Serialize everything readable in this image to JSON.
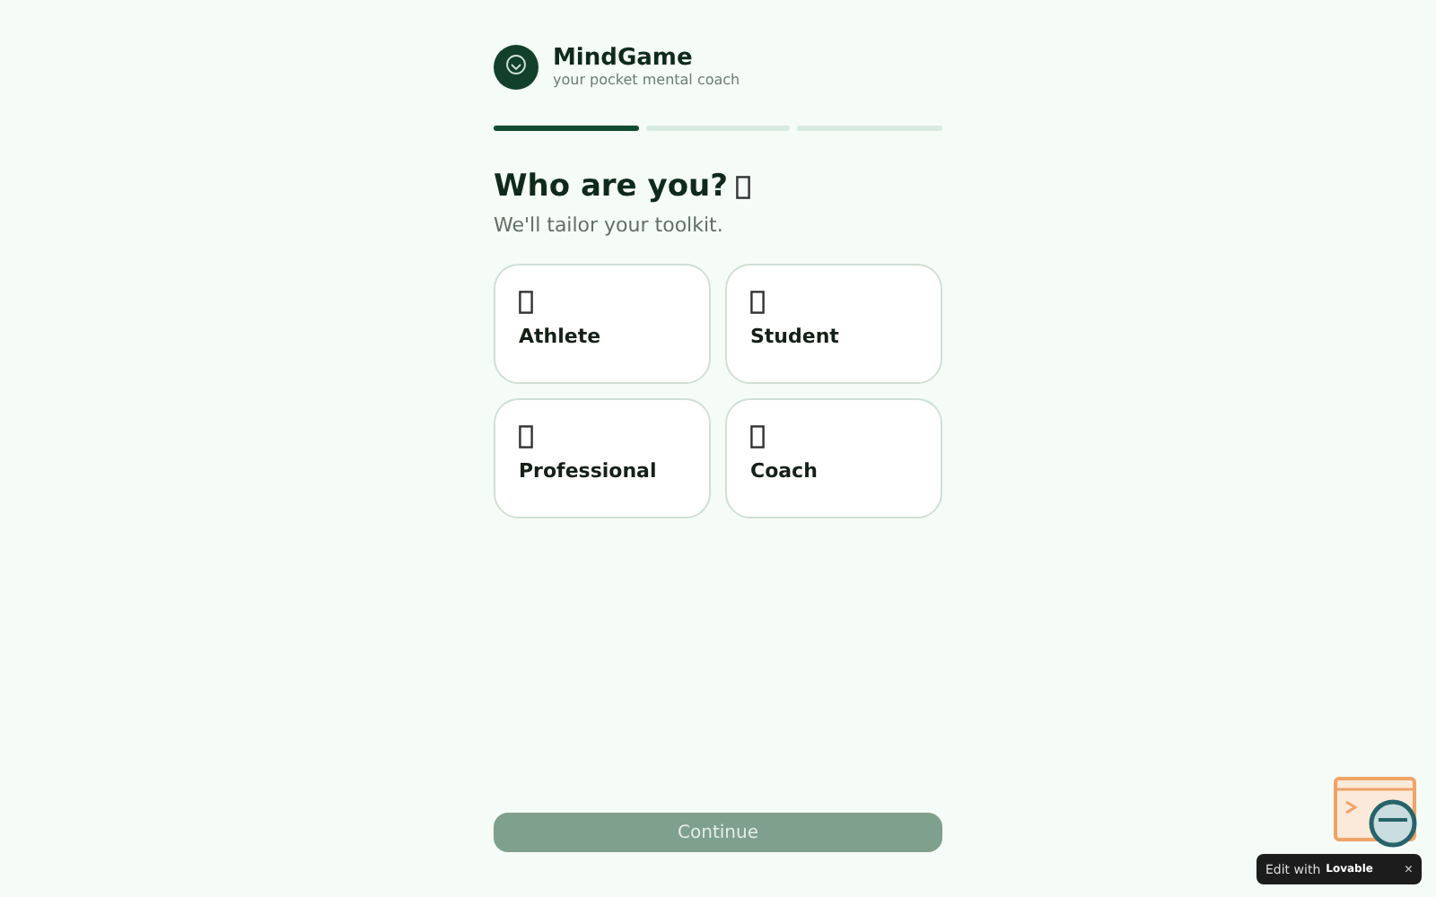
{
  "brand": {
    "name": "MindGame",
    "tagline": "your pocket mental coach"
  },
  "progress": [
    {
      "done": true
    },
    {
      "done": false
    },
    {
      "done": false
    }
  ],
  "heading": "Who are you?",
  "subtitle": "We'll tailor your toolkit.",
  "roles": [
    {
      "label": "Athlete",
      "selected": false
    },
    {
      "label": "Student",
      "selected": false
    },
    {
      "label": "Professional",
      "selected": false
    },
    {
      "label": "Coach",
      "selected": false
    }
  ],
  "continue_button": {
    "label": "Continue",
    "disabled": true
  },
  "edit_badge": {
    "prefix": "Edit with",
    "brand": "Lovable",
    "close": "×"
  }
}
